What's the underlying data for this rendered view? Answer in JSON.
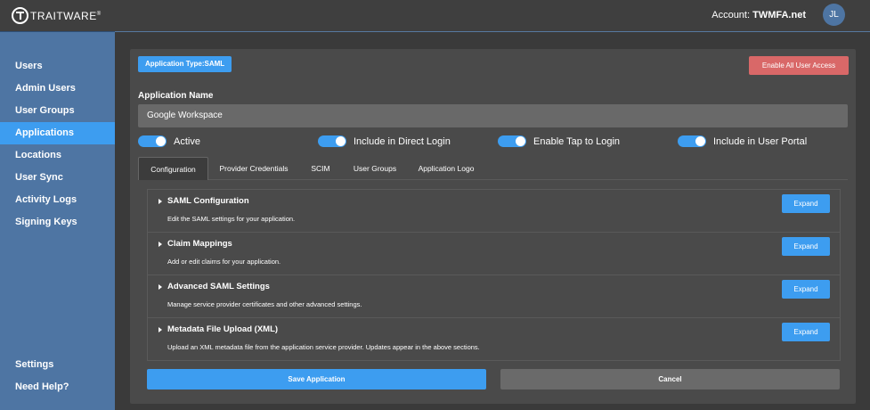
{
  "brand": {
    "name": "TRAITWARE",
    "mark": "®"
  },
  "header": {
    "account_label": "Account:",
    "account_name": "TWMFA.net",
    "avatar_initials": "JL"
  },
  "sidebar": {
    "items": [
      {
        "label": "Users"
      },
      {
        "label": "Admin Users"
      },
      {
        "label": "User Groups"
      },
      {
        "label": "Applications",
        "active": true
      },
      {
        "label": "Locations"
      },
      {
        "label": "User Sync"
      },
      {
        "label": "Activity Logs"
      },
      {
        "label": "Signing Keys"
      }
    ],
    "bottom_items": [
      {
        "label": "Settings"
      },
      {
        "label": "Need Help?"
      }
    ]
  },
  "app": {
    "type_badge": "Application Type:SAML",
    "enable_all_label": "Enable All User Access",
    "name_label": "Application Name",
    "name_value": "Google Workspace",
    "toggles": [
      {
        "label": "Active",
        "on": true
      },
      {
        "label": "Include in Direct Login",
        "on": true
      },
      {
        "label": "Enable Tap to Login",
        "on": true
      },
      {
        "label": "Include in User Portal",
        "on": true
      }
    ],
    "tabs": [
      {
        "label": "Configuration",
        "active": true
      },
      {
        "label": "Provider Credentials"
      },
      {
        "label": "SCIM"
      },
      {
        "label": "User Groups"
      },
      {
        "label": "Application Logo"
      }
    ],
    "sections": [
      {
        "title": "SAML Configuration",
        "description": "Edit the SAML settings for your application.",
        "button": "Expand"
      },
      {
        "title": "Claim Mappings",
        "description": "Add or edit claims for your application.",
        "button": "Expand"
      },
      {
        "title": "Advanced SAML Settings",
        "description": "Manage service provider certificates and other advanced settings.",
        "button": "Expand"
      },
      {
        "title": "Metadata File Upload (XML)",
        "description": "Upload an XML metadata file from the application service provider. Updates appear in the above sections.",
        "button": "Expand"
      }
    ],
    "save_label": "Save Application",
    "cancel_label": "Cancel"
  },
  "colors": {
    "accent": "#3d9df0",
    "sidebar": "#4e75a3",
    "danger": "#d96868"
  }
}
